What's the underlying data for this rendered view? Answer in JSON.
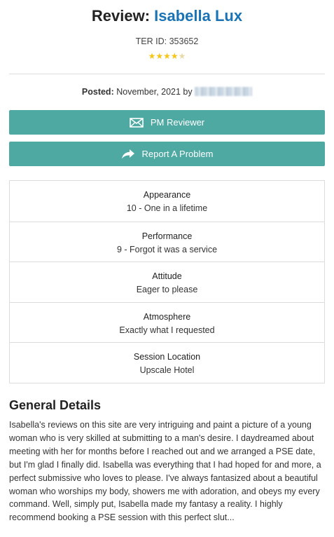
{
  "review": {
    "title_prefix": "Review: ",
    "provider_name": "Isabella Lux",
    "ter_id": "TER ID: 353652",
    "rating_stars": 4.5,
    "rating_display": "★★★★★"
  },
  "posted": {
    "label": "Posted:",
    "date": "November, 2021 by",
    "reviewer_name_hidden": true
  },
  "actions": {
    "pm_label": "PM Reviewer",
    "report_label": "Report A Problem"
  },
  "ratings": [
    {
      "label": "Appearance",
      "value": "10 - One in a lifetime"
    },
    {
      "label": "Performance",
      "value": "9 - Forgot it was a service"
    },
    {
      "label": "Attitude",
      "value": "Eager to please"
    },
    {
      "label": "Atmosphere",
      "value": "Exactly what I requested"
    },
    {
      "label": "Session Location",
      "value": "Upscale Hotel"
    }
  ],
  "general_details": {
    "heading": "General Details",
    "text": "Isabella's reviews on this site are very intriguing and paint a picture of a young woman who is very skilled at submitting to a man's desire. I daydreamed about meeting with her for months before I reached out and we arranged a PSE date, but I'm glad I finally did. Isabella was everything that I had hoped for and more, a perfect submissive who loves to please. I've always fantasized about a beautiful woman who worships my body, showers me with adoration, and obeys my every command. Well, simply put, Isabella made my fantasy a reality. I highly recommend booking a PSE session with this perfect slut..."
  },
  "colors": {
    "accent": "#4fa9a3",
    "link": "#1a73b5",
    "star": "#f5c518"
  },
  "icons": {
    "pm": "envelope-icon",
    "report": "share-arrow-icon"
  }
}
